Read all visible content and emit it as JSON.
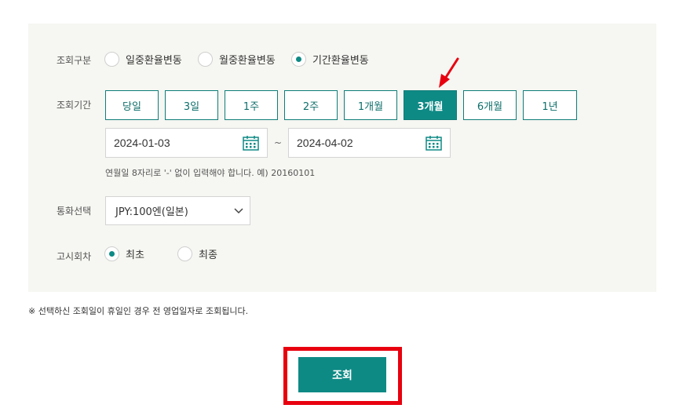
{
  "query_type": {
    "label": "조회구분",
    "options": [
      {
        "label": "일중환율변동",
        "checked": false
      },
      {
        "label": "월중환율변동",
        "checked": false
      },
      {
        "label": "기간환율변동",
        "checked": true
      }
    ]
  },
  "period": {
    "label": "조회기간",
    "buttons": [
      {
        "label": "당일",
        "active": false
      },
      {
        "label": "3일",
        "active": false
      },
      {
        "label": "1주",
        "active": false
      },
      {
        "label": "2주",
        "active": false
      },
      {
        "label": "1개월",
        "active": false
      },
      {
        "label": "3개월",
        "active": true
      },
      {
        "label": "6개월",
        "active": false
      },
      {
        "label": "1년",
        "active": false
      }
    ],
    "start_date": "2024-01-03",
    "separator": "~",
    "end_date": "2024-04-02",
    "hint": "연월일 8자리로 '-' 없이 입력해야 합니다. 예) 20160101"
  },
  "currency": {
    "label": "통화선택",
    "selected": "JPY:100엔(일본)"
  },
  "notice_round": {
    "label": "고시회차",
    "options": [
      {
        "label": "최초",
        "checked": true
      },
      {
        "label": "최종",
        "checked": false
      }
    ]
  },
  "notice": "※ 선택하신 조회일이 휴일인 경우 전 영업일자로 조회됩니다.",
  "submit_label": "조회",
  "colors": {
    "accent": "#0e8a85",
    "panel_bg": "#f6f6f2",
    "annotation_red": "#e8000f"
  },
  "icons": {
    "calendar": "calendar-icon",
    "dropdown": "chevron-down-icon",
    "annotation": "red-arrow-icon"
  }
}
